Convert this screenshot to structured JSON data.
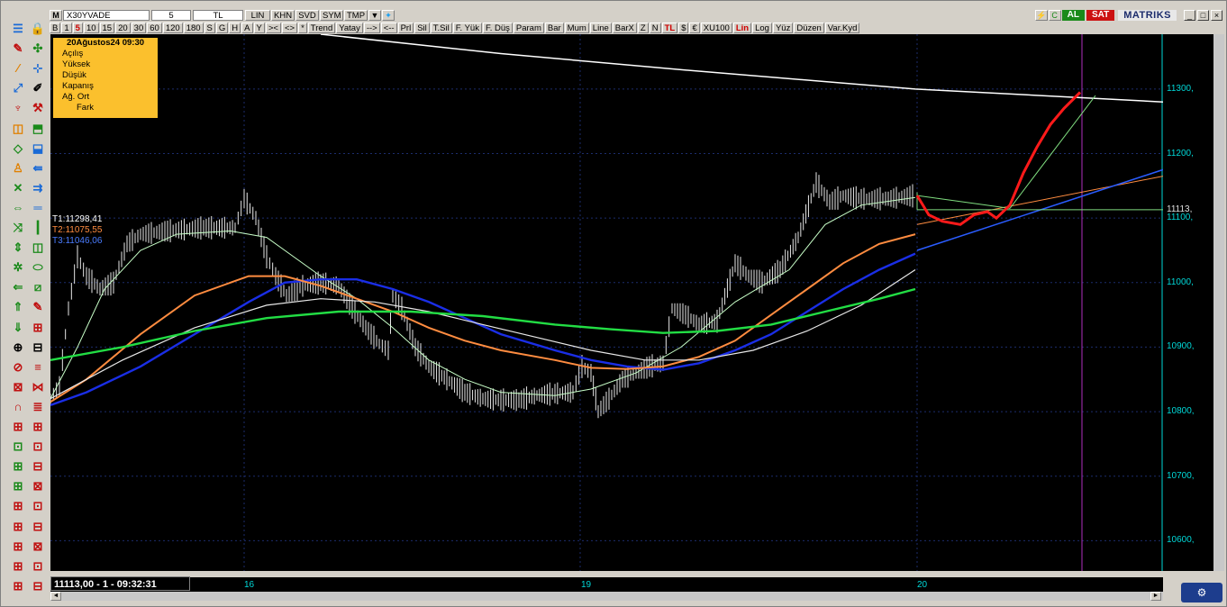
{
  "toolbar": {
    "symbol": "X30YVADE",
    "period": "5",
    "currency": "TL",
    "scale": "LIN",
    "buttons1": [
      "KHN",
      "SVD",
      "SYM",
      "TMP"
    ],
    "buttons2": [
      "B",
      "1",
      "5",
      "10",
      "15",
      "20",
      "30",
      "60",
      "120",
      "180",
      "S",
      "G",
      "H",
      "A",
      "Y",
      "><",
      "<>",
      "*",
      "Trend",
      "Yatay",
      "-->",
      "<--",
      "Prl",
      "Sil",
      "T.Sil",
      "F. Yük",
      "F. Düş",
      "Param",
      "Bar",
      "Mum",
      "Line",
      "BarX",
      "Z",
      "N",
      "TL",
      "$",
      "€",
      "XU100",
      "Lin",
      "Log",
      "Yüz",
      "Düzen",
      "Var.Kyd"
    ],
    "buy_label": "AL",
    "sell_label": "SAT",
    "brand": "MATRIKS"
  },
  "infobox": {
    "date": "20Ağustos24 09:30",
    "rows": [
      "Açılış",
      "Yüksek",
      "Düşük",
      "Kapanış",
      "Ağ. Ort",
      "Fark"
    ]
  },
  "legend": {
    "t1": "T1:11298,41",
    "t2": "T2:11075,55",
    "t3": "T3:11046,06"
  },
  "status": "11113,00 - 1 - 09:32:31",
  "colors": {
    "t1": "#ffffff",
    "t2": "#ff8c40",
    "t3": "#4a7cff",
    "axis": "#00d8d8",
    "price": "#e8e8e8",
    "forecast": "#ff1a1a",
    "ma_green": "#22dd44",
    "ma_blue": "#1a2ee6",
    "ma_light": "#c8ffc8"
  },
  "chart_data": {
    "type": "line",
    "y_ticks": [
      11300,
      11200,
      11100,
      11000,
      10900,
      10800,
      10700,
      10600
    ],
    "y_tick_labels": [
      "11300,",
      "11200,",
      "11100,",
      "11000,",
      "10900,",
      "10800,",
      "10700,",
      "10600,"
    ],
    "current_value_label": "11113,",
    "x_ticks": [
      16,
      19,
      20
    ],
    "x_tick_labels": [
      "16",
      "19",
      "20"
    ],
    "ylim": [
      10553,
      11385
    ],
    "series": [
      {
        "name": "T1",
        "value": 11298.41
      },
      {
        "name": "T2",
        "value": 11075.55
      },
      {
        "name": "T3",
        "value": 11046.06
      }
    ]
  }
}
